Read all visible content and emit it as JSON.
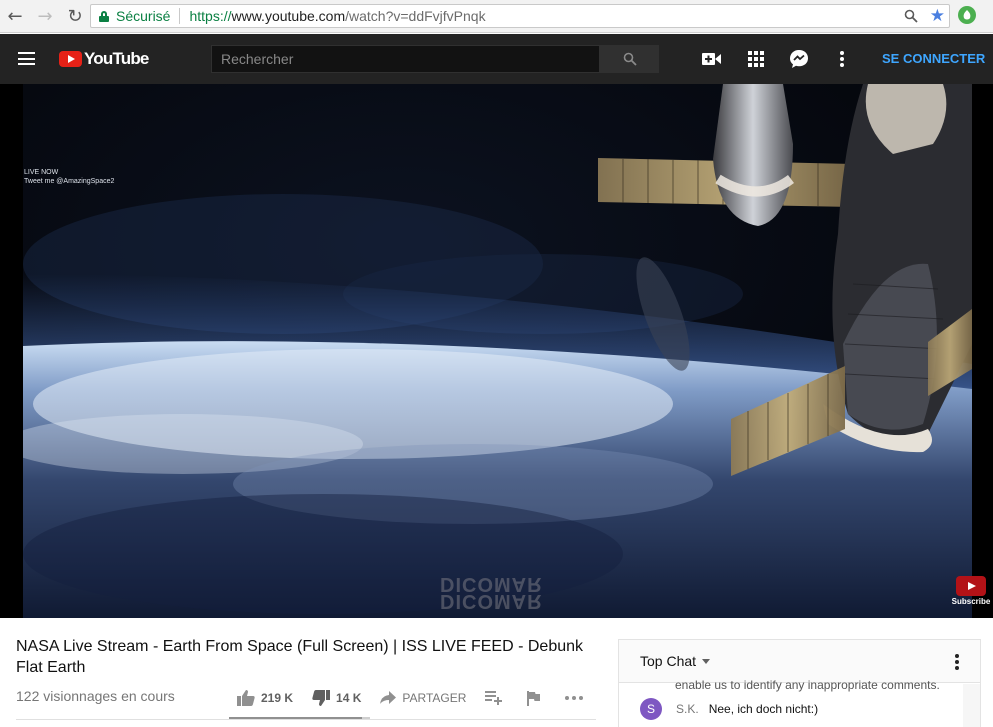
{
  "browser": {
    "secure_label": "Sécurisé",
    "url_scheme": "https://",
    "url_host": "www.youtube.com",
    "url_path": "/watch?v=ddFvjfvPnqk"
  },
  "header": {
    "logo_text": "YouTube",
    "search_placeholder": "Rechercher",
    "signin_label": "SE CONNECTER"
  },
  "video": {
    "overlay_line1": "LIVE NOW",
    "overlay_line2": "Tweet me @AmazingSpace2",
    "watermark_line1": "DICOMAR",
    "watermark_line2": "DICOMAR",
    "subscribe_label": "Subscribe"
  },
  "info": {
    "title": "NASA Live Stream - Earth From Space (Full Screen) | ISS LIVE FEED - Debunk Flat Earth",
    "views": "122 visionnages en cours",
    "likes": "219 K",
    "dislikes": "14 K",
    "share_label": "PARTAGER",
    "like_ratio": 0.94
  },
  "chat": {
    "header_label": "Top Chat",
    "notice": "enable us to identify any inappropriate comments.",
    "messages": [
      {
        "avatar_letter": "S",
        "author": "S.K.",
        "text": "Nee, ich doch nicht:)"
      }
    ]
  },
  "colors": {
    "brand_red": "#e62117",
    "header_bg": "#232323",
    "link_blue": "#3ea6ff",
    "secure_green": "#0b8043"
  }
}
